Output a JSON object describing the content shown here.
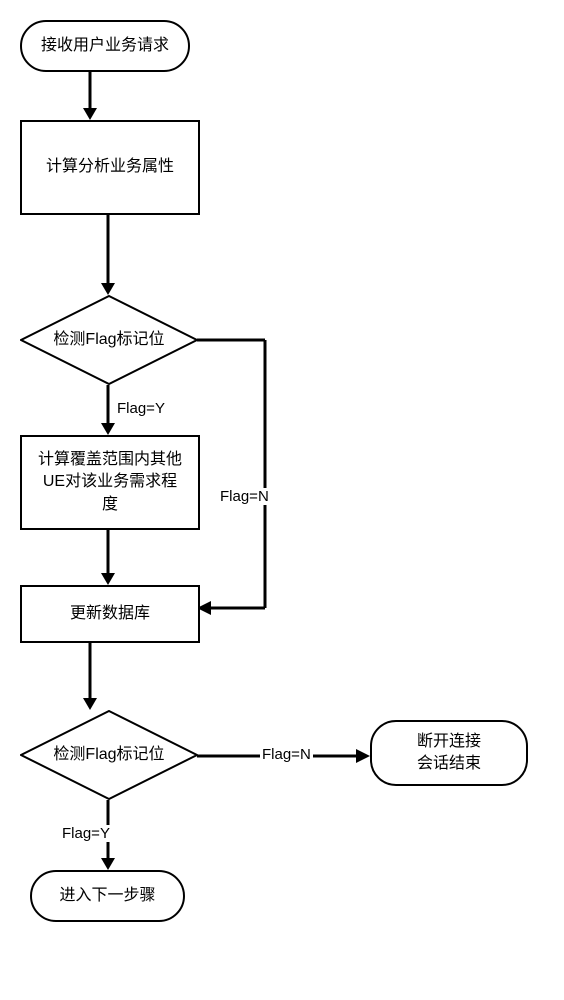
{
  "nodes": {
    "start": {
      "text": "接收用户业务请求"
    },
    "analyze": {
      "text": "计算分析业务属性"
    },
    "check1": {
      "text": "检测Flag标记位"
    },
    "compute": {
      "text": "计算覆盖范围内其他UE对该业务需求程度"
    },
    "update": {
      "text": "更新数据库"
    },
    "check2": {
      "text": "检测Flag标记位"
    },
    "end_disconnect": {
      "text": "断开连接\n会话结束"
    },
    "end_next": {
      "text": "进入下一步骤"
    }
  },
  "edges": {
    "check1_yes": "Flag=Y",
    "check1_no": "Flag=N",
    "check2_yes": "Flag=Y",
    "check2_no": "Flag=N"
  }
}
